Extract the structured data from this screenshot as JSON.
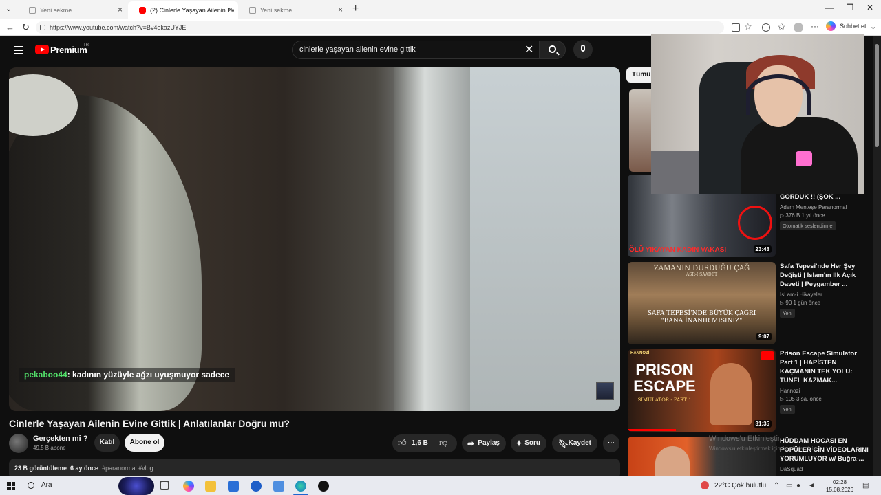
{
  "browser": {
    "tabs": [
      {
        "label": "Yeni sekme",
        "active": false
      },
      {
        "label": "(2) Cinlerle Yaşayan Ailenin Evine G",
        "active": true
      },
      {
        "label": "Yeni sekme",
        "active": false
      }
    ],
    "url": "https://www.youtube.com/watch?v=Bv4okazUYJE",
    "copilot_label": "Sohbet et"
  },
  "youtube": {
    "brand": "Premium",
    "country": "TR",
    "search_query": "cinlerle yaşayan ailenin evine gittik"
  },
  "overlay": {
    "chat_user": "pekaboo44",
    "chat_message": ": kadının yüzüyle ağzı uyuşmuyor sadece"
  },
  "video": {
    "title": "Cinlerle Yaşayan Ailenin Evine Gittik | Anlatılanlar Doğru mu?",
    "channel": "Gerçekten mi ?",
    "subscribers": "49,5 B abone",
    "join_label": "Katıl",
    "subscribe_label": "Abone ol",
    "likes": "1,6 B",
    "share_label": "Paylaş",
    "ask_label": "Soru",
    "save_label": "Kaydet",
    "views": "23 B görüntüleme",
    "age": "6 ay önce",
    "tags": "#paranormal #vlog"
  },
  "sidebar": {
    "filter_chip": "Tümü",
    "videos": [
      {
        "title": "GÖRDÜK !! (ŞOK ...",
        "channel": "Adem Menteşe Paranormal",
        "meta": "▷ 376 B   1 yıl önce",
        "badge": "Otomatik seslendirme",
        "duration": "23:48",
        "thumb_text": "ÖLÜ YIKAYAN KADIN VAKASI"
      },
      {
        "title": "Safa Tepesi'nde Her Şey Değişti | İslam'ın İlk Açık Daveti | Peygamber ...",
        "channel": "İsLam-i Hikayeler",
        "meta": "▷ 90   1 gün önce",
        "badge": "Yeni",
        "duration": "9:07",
        "thumb_top": "ZAMANIN DURDUĞU ÇAĞ",
        "thumb_sub": "ASR-I SAADET",
        "thumb_text": "SAFA TEPESİ'NDE BÜYÜK ÇAĞRI \"BANA İNANIR MISINIZ\""
      },
      {
        "title": "Prison Escape Simulator Part 1 | HAPİSTEN KAÇMANIN TEK YOLU: TÜNEL KAZMAK...",
        "channel": "Hannozi",
        "meta": "▷ 105   3 sa. önce",
        "badge": "Yeni",
        "duration": "31:35",
        "thumb_brand": "HANNOZİ",
        "thumb_text": "PRISON ESCAPE",
        "thumb_sub": "SIMULATOR - PART 1"
      },
      {
        "title": "HÜDDAM HOCASI EN POPÜLER CİN VİDEOLARINI YORUMLUYOR w/ Buğra-...",
        "channel": "DaSquad"
      }
    ]
  },
  "system": {
    "activation_title": "Windows'u Etkinleştir",
    "activation_sub": "Windows'u etkinleştirmek için Ayarlar'a gidin.",
    "search_label": "Ara",
    "weather": "22°C  Çok bulutlu",
    "time": "02:28",
    "date": "15.08.2026"
  }
}
